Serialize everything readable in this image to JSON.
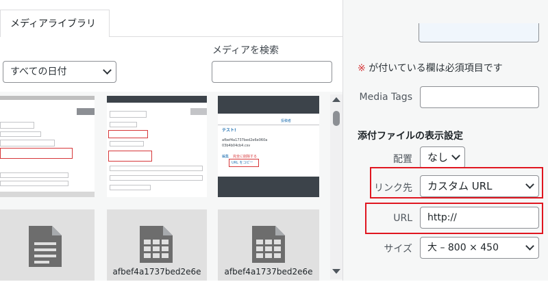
{
  "tab": {
    "label": "メディアライブラリ"
  },
  "filter": {
    "date_label": "すべての日付"
  },
  "search": {
    "label": "メディアを検索",
    "value": ""
  },
  "thumbnails": {
    "items": [
      {
        "kind": "screenshot"
      },
      {
        "kind": "screenshot"
      },
      {
        "kind": "screenshot",
        "heading": "テスト!",
        "hash": "afbef4a1737bed2e6e060a",
        "file": "03b4b04cb4.csv",
        "link_edit": "編集",
        "link_delete": "完全に削除する",
        "link_copy": "URL をコピー",
        "link_col_author": "投稿者"
      },
      {
        "kind": "document"
      },
      {
        "kind": "spreadsheet",
        "name": "afbef4a1737bed2e6e"
      },
      {
        "kind": "spreadsheet",
        "name": "afbef4a1737bed2e6e"
      }
    ]
  },
  "details": {
    "required_mark": "※",
    "required_note": " が付いている欄は必須項目です",
    "media_tags_label": "Media Tags",
    "media_tags_value": "",
    "attachment_heading": "添付ファイルの表示設定",
    "align_label": "配置",
    "align_value": "なし",
    "link_label": "リンク先",
    "link_value": "カスタム URL",
    "url_label": "URL",
    "url_value": "http://",
    "size_label": "サイズ",
    "size_value": "大 – 800 × 450"
  },
  "colors": {
    "highlight_red": "#e0151f",
    "link_blue": "#2271b1"
  }
}
